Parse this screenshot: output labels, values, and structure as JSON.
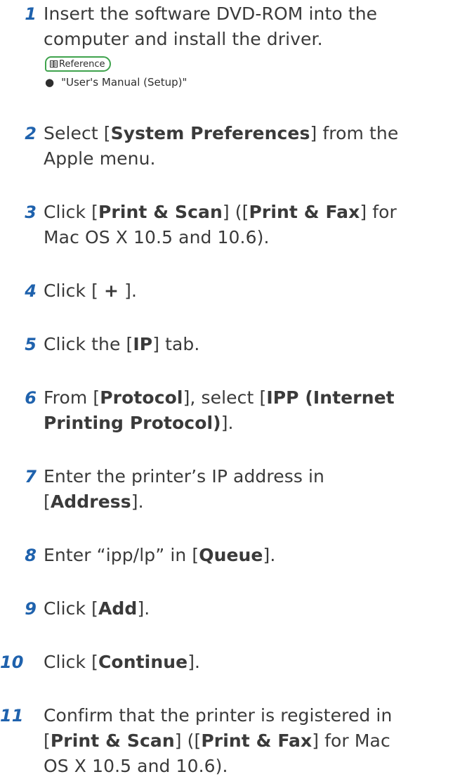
{
  "steps": [
    {
      "num": "1",
      "parts": [
        [
          "Insert the software DVD-ROM into the",
          ""
        ],
        [
          "computer and install the driver.",
          ""
        ]
      ]
    },
    {
      "num": "2"
    },
    {
      "num": "3"
    },
    {
      "num": "4"
    },
    {
      "num": "5"
    },
    {
      "num": "6"
    },
    {
      "num": "7"
    },
    {
      "num": "8"
    },
    {
      "num": "9"
    },
    {
      "num": "10"
    },
    {
      "num": "11"
    }
  ],
  "reference": {
    "label": "Reference",
    "items": [
      "\"User's Manual (Setup)\""
    ],
    "bullet": "●"
  },
  "text": {
    "s1_l1": "Insert the software DVD-ROM into the",
    "s1_l2": "computer and install the driver.",
    "s2_a": "Select [",
    "s2_b": "System Preferences",
    "s2_c": "] from the",
    "s2_l2": "Apple menu.",
    "s3_a": "Click [",
    "s3_b": "Print & Scan",
    "s3_c": "] ([",
    "s3_d": "Print & Fax",
    "s3_e": "] for",
    "s3_l2": "Mac OS X 10.5 and 10.6).",
    "s4_a": "Click [ ",
    "s4_b": "+",
    "s4_c": " ].",
    "s5_a": "Click the [",
    "s5_b": "IP",
    "s5_c": "] tab.",
    "s6_a": "From [",
    "s6_b": "Protocol",
    "s6_c": "], select [",
    "s6_d": "IPP (Internet",
    "s6_l2_b": "Printing Protocol)",
    "s6_l2_c": "].",
    "s7_l1": "Enter the printer’s IP address in",
    "s7_a": "[",
    "s7_b": "Address",
    "s7_c": "].",
    "s8_a": "Enter “ipp/lp” in [",
    "s8_b": "Queue",
    "s8_c": "].",
    "s9_a": "Click [",
    "s9_b": "Add",
    "s9_c": "].",
    "s10_a": "Click [",
    "s10_b": "Continue",
    "s10_c": "].",
    "s11_l1": "Confirm that the printer is registered in",
    "s11_a": "[",
    "s11_b": "Print & Scan",
    "s11_c": "] ([",
    "s11_d": "Print & Fax",
    "s11_e": "] for Mac",
    "s11_l3": "OS X 10.5 and 10.6)."
  },
  "colors": {
    "step_number": "#1f62ad",
    "body_text": "#3a3a3a",
    "reference_border": "#3fa34d"
  }
}
